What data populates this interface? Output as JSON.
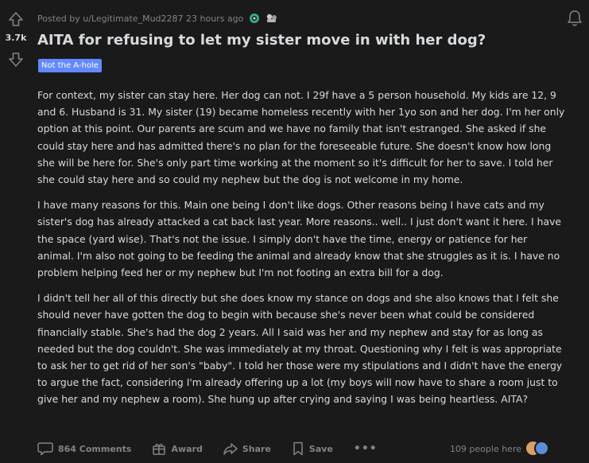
{
  "post": {
    "score": "3.7k",
    "meta": "Posted by u/Legitimate_Mud2287 23 hours ago",
    "title": "AITA for refusing to let my sister move in with her dog?",
    "flair": "Not the A-hole",
    "paragraphs": [
      "For context, my sister can stay here. Her dog can not. I 29f have a 5 person household. My kids are 12, 9 and 6. Husband is 31. My sister (19) became homeless recently with her 1yo son and her dog. I'm her only option at this point. Our parents are scum and we have no family that isn't estranged. She asked if she could stay here and has admitted there's no plan for the foreseeable future. She doesn't know how long she will be here for. She's only part time working at the moment so it's difficult for her to save. I told her she could stay here and so could my nephew but the dog is not welcome in my home.",
      "I have many reasons for this. Main one being I don't like dogs. Other reasons being I have cats and my sister's dog has already attacked a cat back last year. More reasons.. well.. I just don't want it here. I have the space (yard wise). That's not the issue. I simply don't have the time, energy or patience for her animal. I'm also not going to be feeding the animal and already know that she struggles as it is. I have no problem helping feed her or my nephew but I'm not footing an extra bill for a dog.",
      "I didn't tell her all of this directly but she does know my stance on dogs and she also knows that I felt she should never have gotten the dog to begin with because she's never been what could be considered financially stable. She's had the dog 2 years. All I said was her and my nephew and stay for as long as needed but the dog couldn't. She was immediately at my throat. Questioning why I felt is was appropriate to ask her to get rid of her son's \"baby\". I told her those were my stipulations and I didn't have the energy to argue the fact, considering I'm already offering up a lot (my boys will now have to share a room just to give her and my nephew a room). She hung up after crying and saying I was being heartless. AITA?"
    ]
  },
  "actions": {
    "comments": "864 Comments",
    "award": "Award",
    "share": "Share",
    "save": "Save",
    "more": "•••"
  },
  "presence": "109 people here",
  "icons": {
    "upvote": "arrow-up-icon",
    "downvote": "arrow-down-icon",
    "comments": "comment-bubble-icon",
    "award": "gift-icon",
    "share": "share-arrow-icon",
    "save": "bookmark-icon",
    "notifications": "bell-icon"
  },
  "colors": {
    "background": "#1a1a1b",
    "text": "#d7dadc",
    "muted": "#818384",
    "flair": "#6289ff"
  }
}
